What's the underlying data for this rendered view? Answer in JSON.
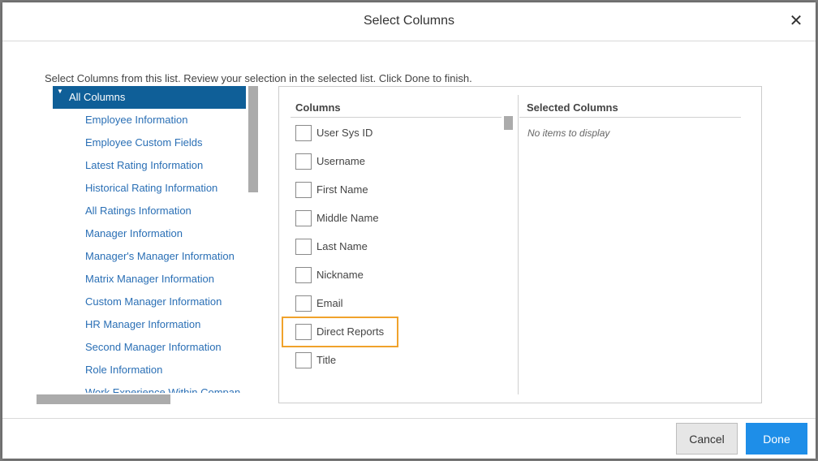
{
  "dialog": {
    "title": "Select Columns",
    "close_icon": "close-icon",
    "close_glyph": "✕",
    "instructions": "Select Columns from this list. Review your selection in the selected list. Click Done to finish."
  },
  "categories": {
    "selected": "All Columns",
    "expand_glyph": "▼",
    "items": [
      "Employee Information",
      "Employee Custom Fields",
      "Latest Rating Information",
      "Historical Rating Information",
      "All Ratings Information",
      "Manager Information",
      "Manager's Manager Information",
      "Matrix Manager Information",
      "Custom Manager Information",
      "HR Manager Information",
      "Second Manager Information",
      "Role Information",
      "Work Experience Within Compan"
    ]
  },
  "columns": {
    "header": "Columns",
    "items": [
      {
        "label": "User Sys ID",
        "checked": false
      },
      {
        "label": "Username",
        "checked": false
      },
      {
        "label": "First Name",
        "checked": false
      },
      {
        "label": "Middle Name",
        "checked": false
      },
      {
        "label": "Last Name",
        "checked": false
      },
      {
        "label": "Nickname",
        "checked": false
      },
      {
        "label": "Email",
        "checked": false
      },
      {
        "label": "Direct Reports",
        "checked": false
      },
      {
        "label": "Title",
        "checked": false
      }
    ],
    "highlighted": "Direct Reports"
  },
  "selected_columns": {
    "header": "Selected Columns",
    "empty_text": "No items to display"
  },
  "footer": {
    "cancel_label": "Cancel",
    "done_label": "Done"
  },
  "colors": {
    "accent": "#1e8ee8",
    "selected_bg": "#0f5f98",
    "link": "#2a6fb5",
    "highlight": "#f0a22b"
  }
}
